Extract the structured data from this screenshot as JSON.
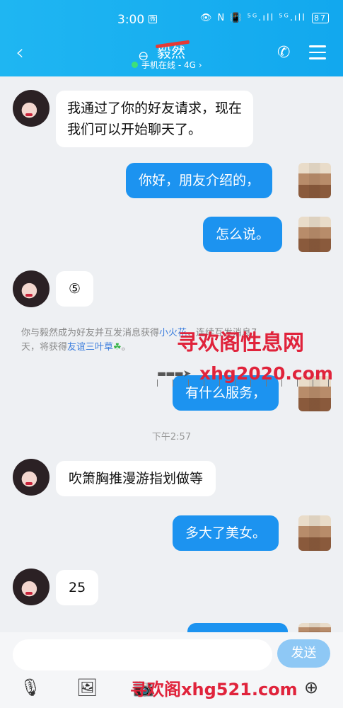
{
  "status_bar": {
    "time": "3:00",
    "app_badge": "微",
    "icons_text": "👁 N 📳 ⁵ᴳ.ıll ⁵ᴳ.ıll",
    "battery": "87"
  },
  "header": {
    "back_icon": "chevron-left",
    "contact_name": "毅然",
    "presence": "手机在线 - 4G",
    "presence_arrow": "›",
    "call_icon": "phone",
    "menu_icon": "hamburger"
  },
  "messages": [
    {
      "side": "in",
      "text_lines": [
        "我通过了你的好友请求，现在",
        "我们可以开始聊天了。"
      ]
    },
    {
      "side": "out",
      "text": "你好，朋友介绍的，"
    },
    {
      "side": "out",
      "text": "怎么说。"
    },
    {
      "side": "in",
      "text": "⑤"
    },
    {
      "side": "out",
      "text": "有什么服务，"
    },
    {
      "side": "in",
      "text": "吹箫胸推漫游指划做等"
    },
    {
      "side": "out",
      "text": "多大了美女。"
    },
    {
      "side": "in",
      "text": "25"
    }
  ],
  "system_note": {
    "line1": "你与毅然成为好友并互发消息获得",
    "link1": "小火花",
    "line1_rest": "，连续互发消息7",
    "line2": "天，将获得",
    "link2": "友谊三叶草",
    "clover": "☘",
    "line2_end": "。"
  },
  "timestamp": "下午2:57",
  "watermarks": {
    "top": "寻欢阁性息网",
    "mid": "xhg2020.com",
    "bottom": "寻欢阁xhg521.com"
  },
  "input": {
    "placeholder": "",
    "send_label": "发送"
  },
  "toolbar_icons": [
    "microphone",
    "image",
    "camera",
    "plus"
  ],
  "colors": {
    "header": "#12a8ee",
    "outgoing_bubble": "#1c93f0",
    "incoming_bubble": "#ffffff",
    "send_button": "#8ec8f5",
    "watermark": "#e0233b"
  }
}
